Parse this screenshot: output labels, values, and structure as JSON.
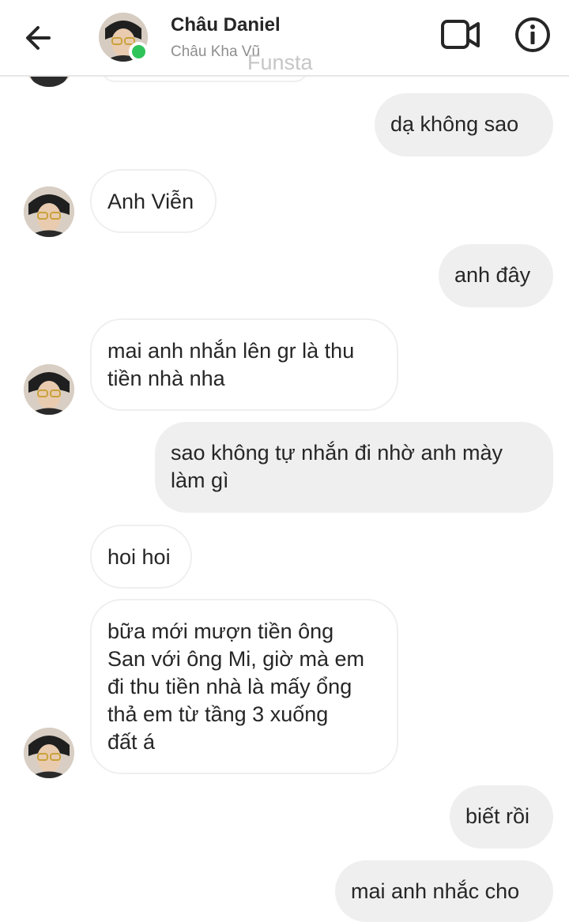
{
  "header": {
    "name": "Châu Daniel",
    "username": "Châu Kha Vũ",
    "watermark": "Funsta",
    "icons": {
      "back": "back-arrow-icon",
      "video": "video-camera-icon",
      "info": "info-icon"
    },
    "online_color": "#2fc45a"
  },
  "messages": [
    {
      "side": "out",
      "text": "dạ không sao"
    },
    {
      "side": "in",
      "text": "Anh Viễn"
    },
    {
      "side": "out",
      "text": "anh đây"
    },
    {
      "side": "in",
      "lines": [
        "mai anh nhắn lên gr là thu",
        "tiền nhà nha"
      ]
    },
    {
      "side": "out",
      "lines": [
        "sao không tự nhắn đi nhờ anh mày",
        "làm gì"
      ]
    },
    {
      "side": "in",
      "text": "hoi hoi"
    },
    {
      "side": "in",
      "lines": [
        "bữa mới mượn tiền ông",
        "San với ông Mi, giờ mà em",
        "đi thu tiền nhà là mấy ổng",
        "thả em từ tầng 3 xuống",
        "đất á"
      ]
    },
    {
      "side": "out",
      "text": "biết rồi"
    },
    {
      "side": "out",
      "text": "mai anh nhắc cho"
    }
  ],
  "colors": {
    "incoming_bubble": "#ffffff",
    "outgoing_bubble": "#efefef",
    "text": "#262626"
  }
}
